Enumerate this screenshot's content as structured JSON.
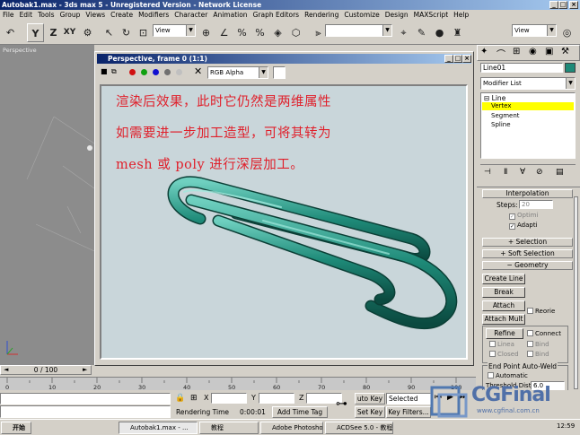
{
  "app": {
    "title": "Autobak1.max - 3ds max 5 - Unregistered Version - Network License"
  },
  "menu": [
    "File",
    "Edit",
    "Tools",
    "Group",
    "Views",
    "Create",
    "Modifiers",
    "Character",
    "Animation",
    "Graph Editors",
    "Rendering",
    "Customize",
    "Design",
    "MAXScript",
    "Help"
  ],
  "toolbar": {
    "view_combo": "View",
    "view_combo2": "View",
    "axis_y": "Y",
    "axis_z": "Z",
    "axis_xy": "XY"
  },
  "viewport": {
    "label": "Perspective"
  },
  "vfw": {
    "title": "Perspective, frame 0 (1:1)",
    "channel": "RGB Alpha"
  },
  "render": {
    "lines": [
      "渲染后效果，此时它仍然是两维属性",
      "如需要进一步加工造型，可将其转为",
      "mesh 或 poly 进行深层加工。"
    ]
  },
  "panel": {
    "object_name": "Line01",
    "modifier_list": "Modifier List",
    "stack": [
      "Line",
      "Vertex",
      "Segment",
      "Spline"
    ],
    "interp_header": "Interpolation",
    "steps_label": "Steps:",
    "steps_value": "20",
    "optimize": "Optimi",
    "adaptive": "Adapti",
    "selection": "Selection",
    "soft_selection": "Soft Selection",
    "geometry": "Geometry",
    "create_line": "Create Line",
    "break": "Break",
    "attach": "Attach",
    "attach_mult": "Attach Mult",
    "reorient": "Reorie",
    "refine": "Refine",
    "connect": "Connect",
    "linear": "Linea",
    "bind_first": "Bind",
    "closed": "Closed",
    "bind_last": "Bind",
    "endpoint_header": "End Point Auto-Weld",
    "automatic": "Automatic",
    "threshold": "Threshold Dist",
    "threshold_value": "6.0"
  },
  "timeline": {
    "frame": "0 / 100",
    "ticks": [
      "0",
      "10",
      "20",
      "30",
      "40",
      "50",
      "60",
      "70",
      "80",
      "90",
      "100"
    ]
  },
  "status": {
    "x_label": "X",
    "y_label": "Y",
    "z_label": "Z",
    "rendering_time_label": "Rendering Time",
    "rendering_time": "0:00:01",
    "add_time_tag": "Add Time Tag",
    "auto_key": "uto Key",
    "selected": "Selected",
    "set_key": "Set Key",
    "key_filters": "Key Filters..."
  },
  "taskbar": {
    "start": "开始",
    "items": [
      "Autobak1.max - ...",
      "教程",
      "Adobe Photoshop",
      "ACDSee 5.0 - 教程"
    ],
    "clock": "12:59"
  },
  "watermark": {
    "brand": "CGFinal",
    "url": "www.cgfinal.com.cn"
  },
  "colors": {
    "title_blue": "#0a246a",
    "render_bg": "#c9d6da",
    "paperclip": "#1e8a78",
    "caption": "#e0202b",
    "vertex_highlight": "#ffff00"
  }
}
